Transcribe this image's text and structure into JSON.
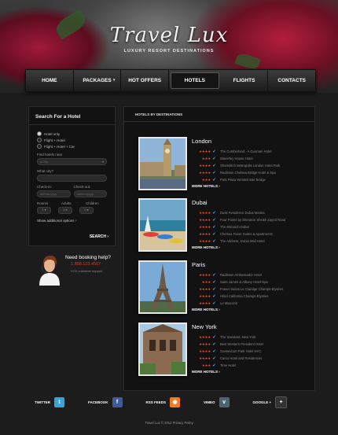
{
  "brand": {
    "title": "Travel Lux",
    "subtitle": "LUXURY RESORT DESTINATIONS"
  },
  "nav": [
    {
      "label": "HOME"
    },
    {
      "label": "PACKAGES",
      "caret": "▾"
    },
    {
      "label": "HOT OFFERS"
    },
    {
      "label": "HOTELS",
      "active": true
    },
    {
      "label": "FLIGHTS"
    },
    {
      "label": "CONTACTS"
    }
  ],
  "search": {
    "title": "Search For a Hotel",
    "options": [
      "Hotel only",
      "Flight + Hotel",
      "Flight + Hotel + Car"
    ],
    "find_label": "Find hotels near",
    "find_value": "a City",
    "what_city_label": "What city?",
    "checkin_label": "Check-in:",
    "checkout_label": "Check-out:",
    "checkin_placeholder": "dd/mm/yyyy",
    "checkout_placeholder": "dd/mm/yyyy",
    "rooms_label": "Rooms",
    "adults_label": "Adults",
    "children_label": "Children",
    "rooms_value": "1",
    "adults_value": "1",
    "children_value": "0",
    "additional": "Show additional options ›",
    "button": "SEARCH ›"
  },
  "booking": {
    "title": "Need booking help?",
    "phone": "1.888.123.4567",
    "note": "VOX customer support"
  },
  "hotels_heading": "HOTELS BY DESTINATIONS",
  "destinations": [
    {
      "name": "London",
      "hotels": [
        "The Cumberland - A Guoman Hotel",
        "Waverley House Hotel",
        "Shoreditch Metropolis London Hotel Park",
        "Radisson Chelsea Bridge Hotel & Spa",
        "Park Plaza Westminster Bridge"
      ],
      "more": "MORE HOTELS ›"
    },
    {
      "name": "Dubai",
      "hotels": [
        "Dusit Residence Dubai Marina",
        "Four Points by Sheraton Sheikh Zayed Road",
        "The Monarch Dubai",
        "Chelsea Tower Suites & Apartments",
        "The Address, Dubai Mall Hotel"
      ],
      "more": "MORE HOTELS ›"
    },
    {
      "name": "Paris",
      "hotels": [
        "Radisson Ambassador Hotel",
        "Saint-James & Albany Hotel-Spa",
        "Fraser Suites Le Claridge Champs-Elysées",
        "Hôtel California Champs-Elysées",
        "Le Marcorin"
      ],
      "more": "MORE HOTELS ›"
    },
    {
      "name": "New York",
      "hotels": [
        "The Standard, New York",
        "Best Western President Hotel",
        "Gansevoort Park Hotel NYC",
        "Carco Hotel and Residences",
        "Time Hotel"
      ],
      "more": "MORE HOTELS ›"
    }
  ],
  "social": [
    {
      "label": "TWITTER",
      "icon": "twitter-icon",
      "glyph": "t",
      "color": "#3aa2d8"
    },
    {
      "label": "FACEBOOK",
      "icon": "facebook-icon",
      "glyph": "f",
      "color": "#3b5b9c"
    },
    {
      "label": "RSS FEEDS",
      "icon": "rss-icon",
      "glyph": "◉",
      "color": "#f07b22"
    },
    {
      "label": "VIMEO",
      "icon": "vimeo-icon",
      "glyph": "v",
      "color": "#4d6573"
    },
    {
      "label": "GOOGLE +",
      "icon": "google-plus-icon",
      "glyph": "+",
      "color": "#333333"
    }
  ],
  "footer": {
    "copyright": "Travel Lux © 2012 Privacy Policy"
  },
  "colors": {
    "accent": "#d83a2a",
    "stars": "#e84d2a",
    "check": "#3aa7e6"
  }
}
